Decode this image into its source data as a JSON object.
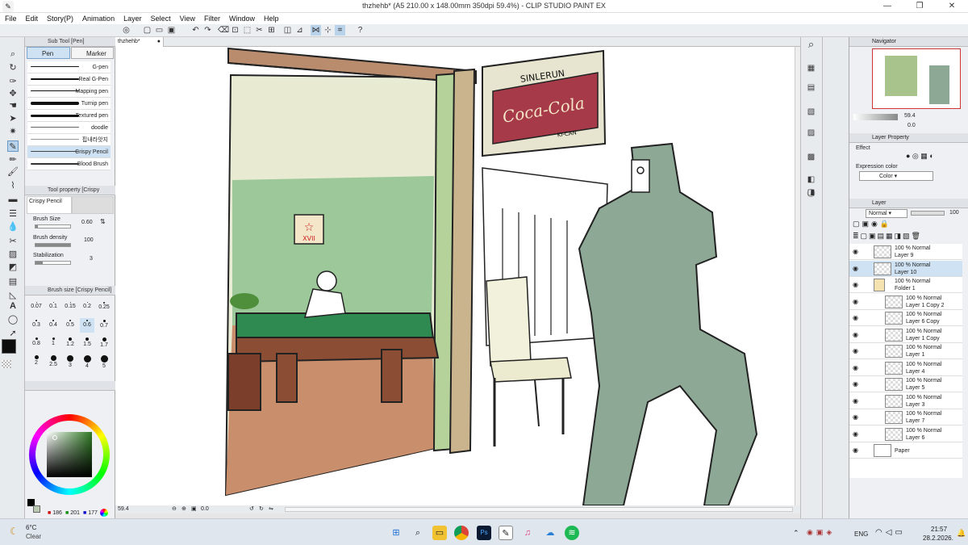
{
  "window": {
    "title": "thzhehb* (A5 210.00 x 148.00mm 350dpi 59.4%) - CLIP STUDIO PAINT EX"
  },
  "menu": [
    "File",
    "Edit",
    "Story(P)",
    "Animation",
    "Layer",
    "Select",
    "View",
    "Filter",
    "Window",
    "Help"
  ],
  "subtool": {
    "header": "Sub Tool [Pen]",
    "tabs": [
      "Pen",
      "Marker"
    ],
    "brushes": [
      "G-pen",
      "Real G-Pen",
      "Mapping pen",
      "Turnip pen",
      "Textured pen",
      "doodle",
      "핍내라앗지",
      "Crispy Pencil",
      "Blood Brush"
    ]
  },
  "tool_property": {
    "header": "Tool property [Crispy Pencil]",
    "name": "Crispy Pencil",
    "brush_size_label": "Brush Size",
    "brush_size": "0.60",
    "brush_density_label": "Brush density",
    "brush_density": "100",
    "stabilization_label": "Stabilization",
    "stabilization": "3"
  },
  "brush_size_panel": {
    "header": "Brush size [Crispy Pencil]",
    "sizes": [
      "0.07",
      "0.1",
      "0.15",
      "0.2",
      "0.25",
      "0.3",
      "0.4",
      "0.5",
      "0.6",
      "0.7",
      "0.8",
      "1",
      "1.2",
      "1.5",
      "1.7",
      "2",
      "2.5",
      "3",
      "4",
      "5"
    ]
  },
  "color": {
    "r": "186",
    "g": "201",
    "b": "177",
    "main": "#0d0d0d",
    "sub": "#bac9b1"
  },
  "document": {
    "tab": "thzhehb*",
    "zoom": "59.4",
    "angle": "0.0"
  },
  "navigator": {
    "header": "Navigator",
    "zoom": "59.4",
    "angle": "0.0"
  },
  "layer_property": {
    "header": "Layer Property",
    "effect_label": "Effect",
    "expression_label": "Expression color",
    "expression_value": "Color"
  },
  "layer_panel": {
    "header": "Layer",
    "blend": "Normal",
    "opacity": "100",
    "layers": [
      {
        "mode": "100 % Normal",
        "name": "Layer 9"
      },
      {
        "mode": "100 % Normal",
        "name": "Layer 10"
      },
      {
        "mode": "100 % Normal",
        "name": "Folder 1"
      },
      {
        "mode": "100 % Normal",
        "name": "Layer 1 Copy 2"
      },
      {
        "mode": "100 % Normal",
        "name": "Layer 6 Copy"
      },
      {
        "mode": "100 % Normal",
        "name": "Layer 1 Copy"
      },
      {
        "mode": "100 % Normal",
        "name": "Layer 1"
      },
      {
        "mode": "100 % Normal",
        "name": "Layer 4"
      },
      {
        "mode": "100 % Normal",
        "name": "Layer 5"
      },
      {
        "mode": "100 % Normal",
        "name": "Layer 3"
      },
      {
        "mode": "100 % Normal",
        "name": "Layer 7"
      },
      {
        "mode": "100 % Normal",
        "name": "Layer 6"
      },
      {
        "mode": "",
        "name": "Paper"
      }
    ]
  },
  "artwork": {
    "sign_top": "SINLERUN",
    "sign_main": "Coca-Cola",
    "sign_bottom": "KI-CAN",
    "poster": "XVII"
  },
  "taskbar": {
    "weather_temp": "6°C",
    "weather_desc": "Clear",
    "lang": "ENG",
    "time": "21:57",
    "date": "28.2.2026."
  }
}
